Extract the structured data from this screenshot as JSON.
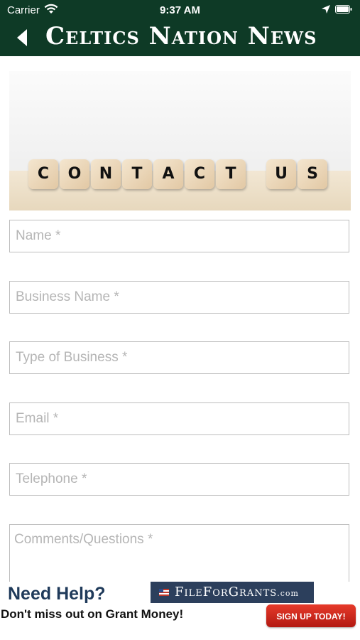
{
  "status_bar": {
    "carrier": "Carrier",
    "time": "9:37 AM"
  },
  "nav": {
    "title": "Celtics Nation News"
  },
  "hero": {
    "letters": [
      "C",
      "O",
      "N",
      "T",
      "A",
      "C",
      "T",
      "U",
      "S"
    ]
  },
  "form": {
    "name_placeholder": "Name *",
    "business_name_placeholder": "Business Name *",
    "business_type_placeholder": "Type of Business *",
    "email_placeholder": "Email *",
    "telephone_placeholder": "Telephone *",
    "comments_placeholder": "Comments/Questions *"
  },
  "ad": {
    "headline": "Need Help?",
    "subline": "Don't miss out on Grant Money!",
    "brand_name": "FileForGrants",
    "brand_domain": ".com",
    "cta": "SIGN UP TODAY!"
  },
  "colors": {
    "header_green": "#0e3a26",
    "cta_red": "#d42a1c",
    "brand_navy": "#2c3f5c"
  }
}
